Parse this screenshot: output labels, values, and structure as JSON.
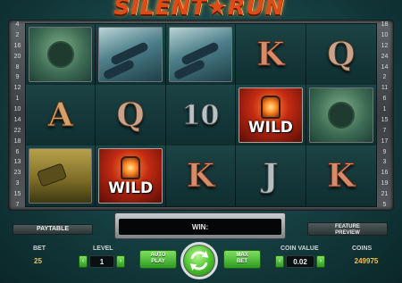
{
  "game": {
    "title": "SILENT★RUN"
  },
  "paylines": {
    "left": [
      "4",
      "2",
      "16",
      "20",
      "8",
      "9",
      "12",
      "1",
      "10",
      "14",
      "22",
      "18",
      "6",
      "13",
      "23",
      "3",
      "15",
      "7"
    ],
    "right": [
      "18",
      "10",
      "12",
      "24",
      "14",
      "2",
      "11",
      "6",
      "1",
      "15",
      "7",
      "17",
      "9",
      "3",
      "16",
      "19",
      "21",
      "5"
    ]
  },
  "reels": [
    [
      "mine",
      "sub",
      "sub",
      "K",
      "Q"
    ],
    [
      "A",
      "Q",
      "10",
      "WILD",
      "mine"
    ],
    [
      "barrel",
      "WILD",
      "K",
      "J",
      "K"
    ]
  ],
  "symbols": {
    "wild_label": "WILD"
  },
  "controls": {
    "paytable": "PAYTABLE",
    "feature_preview_line1": "FEATURE",
    "feature_preview_line2": "PREVIEW",
    "win_label": "WIN:",
    "bet_label": "BET",
    "bet_value": "25",
    "level_label": "LEVEL",
    "level_value": "1",
    "autoplay_line1": "AUTO",
    "autoplay_line2": "PLAY",
    "maxbet_line1": "MAX",
    "maxbet_line2": "BET",
    "coin_value_label": "COIN VALUE",
    "coin_value": "0.02",
    "coins_label": "COINS",
    "coins_value": "249975",
    "decrease_arrow": "‹",
    "increase_arrow": "›"
  },
  "colors": {
    "accent_green": "#4cc22e",
    "title_orange": "#e04a18"
  }
}
